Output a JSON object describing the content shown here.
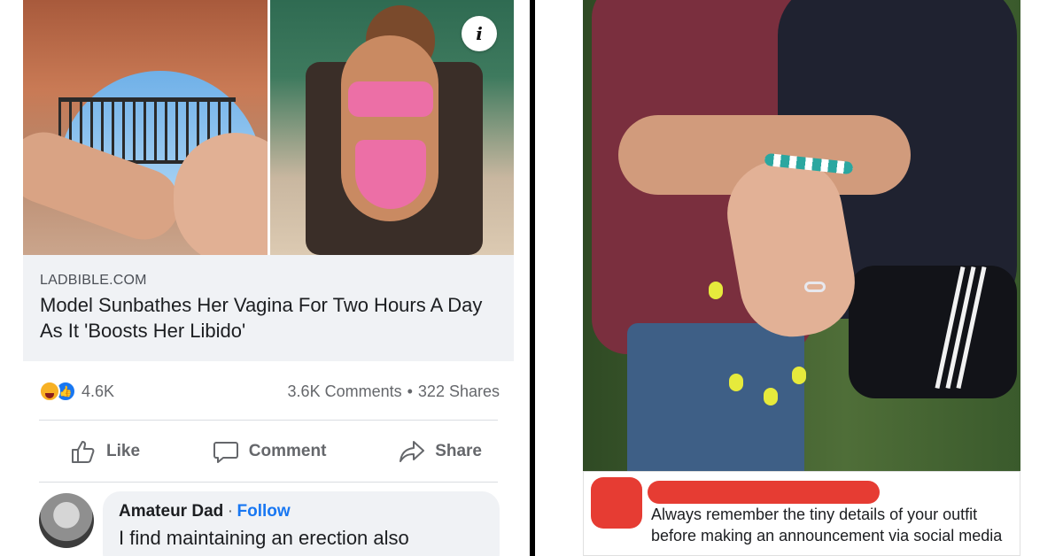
{
  "left_post": {
    "link_domain": "LADBIBLE.COM",
    "link_title": "Model Sunbathes Her Vagina For Two Hours A Day As It 'Boosts Her Libido'",
    "info_glyph": "i",
    "reaction_count": "4.6K",
    "comments_count": "3.6K Comments",
    "dot_separator": "•",
    "shares_count": "322 Shares",
    "actions": {
      "like": "Like",
      "comment": "Comment",
      "share": "Share"
    },
    "comment": {
      "author": "Amateur Dad",
      "separator": "·",
      "follow": "Follow",
      "text": "I find maintaining an erection also"
    },
    "colors": {
      "like_blue": "#1877f2",
      "haha_yellow": "#f7b125",
      "text_gray": "#65676b",
      "preview_bg": "#f0f2f5"
    },
    "icons": [
      "info-icon",
      "haha-reaction-icon",
      "like-reaction-icon",
      "thumbs-up-icon",
      "comment-bubble-icon",
      "share-arrow-icon"
    ]
  },
  "right_post": {
    "caption": "Always remember the tiny details of your outfit before making an announcement via social media",
    "colors": {
      "redaction_red": "#e63c33"
    }
  }
}
